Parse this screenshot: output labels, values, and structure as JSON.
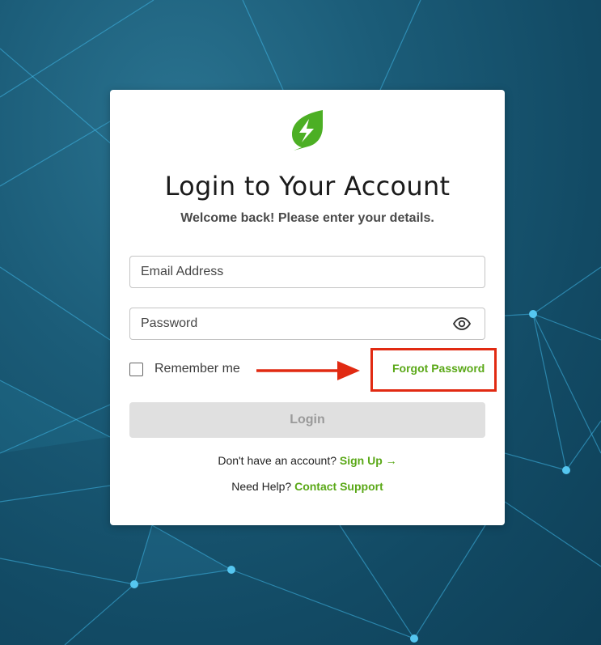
{
  "login": {
    "title": "Login to Your Account",
    "subtitle": "Welcome back! Please enter your details.",
    "email_placeholder": "Email Address",
    "password_placeholder": "Password",
    "remember_label": "Remember me",
    "forgot_label": "Forgot Password",
    "login_button": "Login",
    "signup_prompt": "Don't have an account?",
    "signup_link": "Sign Up →",
    "help_prompt": "Need Help?",
    "support_link": "Contact Support"
  },
  "icons": {
    "logo": "leaf-lightning-logo",
    "password_toggle": "eye-icon",
    "annotation": "red-arrow-icon"
  },
  "colors": {
    "accent": "#5aa817",
    "logo": "#4caf24",
    "highlight": "#e12a12",
    "disabled_button": "#e0e0e0",
    "background": "#1b5c78"
  }
}
